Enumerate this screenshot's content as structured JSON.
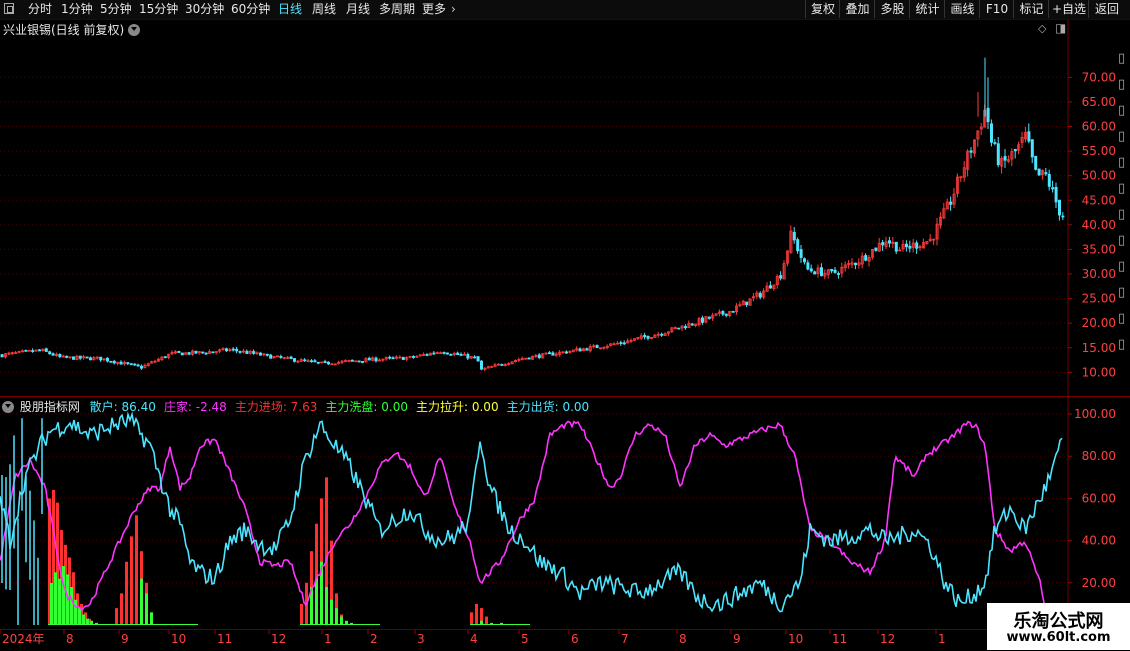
{
  "toolbar": {
    "periods": [
      "分时",
      "1分钟",
      "5分钟",
      "15分钟",
      "30分钟",
      "60分钟",
      "日线",
      "周线",
      "月线",
      "多周期",
      "更多"
    ],
    "active_period": "日线",
    "buttons": [
      "复权",
      "叠加",
      "多股",
      "统计",
      "画线",
      "F10",
      "标记",
      "+自选",
      "返回"
    ]
  },
  "main_panel": {
    "title": "兴业银锡(日线 前复权)",
    "up_color": "#ff3a3a",
    "down_color": "#4de4ff"
  },
  "indicator_panel": {
    "title": "股朋指标网",
    "legend": [
      {
        "label": "散户:",
        "value": "86.40",
        "color": "#4de4ff"
      },
      {
        "label": "庄家:",
        "value": "-2.48",
        "color": "#ff33ff"
      },
      {
        "label": "主力进场:",
        "value": "7.63",
        "color": "#ff3030"
      },
      {
        "label": "主力洗盘:",
        "value": "0.00",
        "color": "#33ff33"
      },
      {
        "label": "主力拉升:",
        "value": "0.00",
        "color": "#ffff33"
      },
      {
        "label": "主力出货:",
        "value": "0.00",
        "color": "#4de4ff"
      }
    ]
  },
  "logo": {
    "line1": "乐淘公式网",
    "line2": "www.60lt.com"
  },
  "chart_data": [
    {
      "type": "candlestick",
      "title": "兴业银锡(日线 前复权)",
      "ylim": [
        6,
        78
      ],
      "y_ticks": [
        10,
        15,
        20,
        25,
        30,
        35,
        40,
        45,
        50,
        55,
        60,
        65,
        70
      ],
      "x_labels": [
        "2024年",
        "8",
        "9",
        "10",
        "11",
        "12",
        "1",
        "2",
        "3",
        "4",
        "5",
        "6",
        "7",
        "8",
        "9",
        "10",
        "11",
        "12",
        "1"
      ],
      "grid": true,
      "close_anchors": [
        [
          0,
          13.5
        ],
        [
          40,
          14.5
        ],
        [
          60,
          13.0
        ],
        [
          100,
          12.8
        ],
        [
          140,
          11.0
        ],
        [
          170,
          13.8
        ],
        [
          200,
          14.0
        ],
        [
          230,
          14.6
        ],
        [
          270,
          13.2
        ],
        [
          320,
          11.8
        ],
        [
          370,
          12.6
        ],
        [
          410,
          13.0
        ],
        [
          440,
          14.3
        ],
        [
          476,
          12.8
        ],
        [
          480,
          10.5
        ],
        [
          520,
          12.8
        ],
        [
          575,
          14.5
        ],
        [
          620,
          16.0
        ],
        [
          660,
          18.0
        ],
        [
          700,
          20.5
        ],
        [
          730,
          22.5
        ],
        [
          760,
          26.0
        ],
        [
          780,
          30.0
        ],
        [
          790,
          38.0
        ],
        [
          795,
          36.0
        ],
        [
          805,
          31.0
        ],
        [
          830,
          30.0
        ],
        [
          860,
          33.0
        ],
        [
          885,
          37.0
        ],
        [
          900,
          35.0
        ],
        [
          930,
          37.0
        ],
        [
          950,
          45.0
        ],
        [
          965,
          53.0
        ],
        [
          975,
          58.0
        ],
        [
          985,
          64.0
        ],
        [
          990,
          57.0
        ],
        [
          1000,
          52.0
        ],
        [
          1015,
          55.0
        ],
        [
          1025,
          58.0
        ],
        [
          1035,
          50.0
        ],
        [
          1045,
          50.0
        ],
        [
          1060,
          42.0
        ]
      ]
    },
    {
      "type": "line+bar",
      "title": "股朋指标网",
      "ylim": [
        0,
        100
      ],
      "y_ticks": [
        20,
        40,
        60,
        80,
        100
      ],
      "series": [
        {
          "name": "散户",
          "color": "#4de4ff",
          "last": 86.4,
          "anchors": [
            [
              0,
              60
            ],
            [
              10,
              40
            ],
            [
              25,
              70
            ],
            [
              40,
              85
            ],
            [
              50,
              92
            ],
            [
              70,
              96
            ],
            [
              90,
              90
            ],
            [
              110,
              94
            ],
            [
              130,
              97
            ],
            [
              150,
              85
            ],
            [
              160,
              70
            ],
            [
              170,
              55
            ],
            [
              180,
              48
            ],
            [
              190,
              30
            ],
            [
              200,
              25
            ],
            [
              215,
              22
            ],
            [
              230,
              40
            ],
            [
              245,
              45
            ],
            [
              260,
              38
            ],
            [
              275,
              36
            ],
            [
              290,
              50
            ],
            [
              305,
              78
            ],
            [
              320,
              95
            ],
            [
              335,
              85
            ],
            [
              350,
              75
            ],
            [
              365,
              60
            ],
            [
              380,
              45
            ],
            [
              395,
              50
            ],
            [
              410,
              55
            ],
            [
              425,
              45
            ],
            [
              440,
              40
            ],
            [
              455,
              42
            ],
            [
              470,
              50
            ],
            [
              480,
              90
            ],
            [
              490,
              65
            ],
            [
              500,
              55
            ],
            [
              510,
              45
            ],
            [
              525,
              40
            ],
            [
              540,
              30
            ],
            [
              560,
              25
            ],
            [
              580,
              15
            ],
            [
              600,
              20
            ],
            [
              620,
              18
            ],
            [
              640,
              15
            ],
            [
              660,
              20
            ],
            [
              680,
              25
            ],
            [
              700,
              12
            ],
            [
              720,
              10
            ],
            [
              740,
              15
            ],
            [
              760,
              20
            ],
            [
              780,
              10
            ],
            [
              800,
              20
            ],
            [
              810,
              45
            ],
            [
              830,
              40
            ],
            [
              850,
              42
            ],
            [
              870,
              45
            ],
            [
              885,
              40
            ],
            [
              900,
              42
            ],
            [
              915,
              45
            ],
            [
              930,
              38
            ],
            [
              945,
              20
            ],
            [
              960,
              10
            ],
            [
              975,
              15
            ],
            [
              985,
              20
            ],
            [
              995,
              45
            ],
            [
              1010,
              55
            ],
            [
              1025,
              45
            ],
            [
              1040,
              60
            ],
            [
              1050,
              70
            ],
            [
              1062,
              86.4
            ]
          ]
        },
        {
          "name": "庄家",
          "color": "#ff33ff",
          "last": -2.48,
          "anchors": [
            [
              0,
              30
            ],
            [
              15,
              70
            ],
            [
              30,
              78
            ],
            [
              45,
              65
            ],
            [
              55,
              40
            ],
            [
              65,
              15
            ],
            [
              80,
              8
            ],
            [
              90,
              10
            ],
            [
              105,
              25
            ],
            [
              120,
              40
            ],
            [
              135,
              55
            ],
            [
              150,
              65
            ],
            [
              160,
              65
            ],
            [
              170,
              85
            ],
            [
              180,
              65
            ],
            [
              190,
              70
            ],
            [
              200,
              85
            ],
            [
              215,
              88
            ],
            [
              230,
              72
            ],
            [
              245,
              55
            ],
            [
              260,
              30
            ],
            [
              275,
              28
            ],
            [
              290,
              30
            ],
            [
              305,
              10
            ],
            [
              320,
              25
            ],
            [
              335,
              40
            ],
            [
              350,
              48
            ],
            [
              365,
              60
            ],
            [
              380,
              75
            ],
            [
              395,
              82
            ],
            [
              410,
              75
            ],
            [
              425,
              60
            ],
            [
              440,
              80
            ],
            [
              455,
              55
            ],
            [
              470,
              40
            ],
            [
              480,
              20
            ],
            [
              490,
              25
            ],
            [
              500,
              30
            ],
            [
              520,
              50
            ],
            [
              535,
              60
            ],
            [
              550,
              90
            ],
            [
              565,
              95
            ],
            [
              580,
              95
            ],
            [
              595,
              80
            ],
            [
              610,
              65
            ],
            [
              620,
              70
            ],
            [
              635,
              90
            ],
            [
              650,
              95
            ],
            [
              665,
              90
            ],
            [
              680,
              65
            ],
            [
              695,
              85
            ],
            [
              710,
              90
            ],
            [
              725,
              85
            ],
            [
              740,
              88
            ],
            [
              760,
              92
            ],
            [
              780,
              95
            ],
            [
              795,
              80
            ],
            [
              810,
              45
            ],
            [
              830,
              40
            ],
            [
              850,
              30
            ],
            [
              870,
              25
            ],
            [
              885,
              40
            ],
            [
              895,
              80
            ],
            [
              905,
              75
            ],
            [
              915,
              70
            ],
            [
              925,
              80
            ],
            [
              940,
              85
            ],
            [
              955,
              90
            ],
            [
              965,
              95
            ],
            [
              975,
              95
            ],
            [
              985,
              85
            ],
            [
              995,
              45
            ],
            [
              1010,
              35
            ],
            [
              1025,
              40
            ],
            [
              1040,
              20
            ],
            [
              1050,
              -2.48
            ]
          ]
        },
        {
          "name": "主力进场",
          "color": "#ff3030",
          "last": 7.63,
          "bars": [
            [
              48,
              60
            ],
            [
              52,
              64
            ],
            [
              56,
              58
            ],
            [
              60,
              45
            ],
            [
              64,
              38
            ],
            [
              68,
              32
            ],
            [
              72,
              25
            ],
            [
              76,
              15
            ],
            [
              80,
              10
            ],
            [
              84,
              6
            ],
            [
              88,
              3
            ],
            [
              115,
              8
            ],
            [
              120,
              15
            ],
            [
              125,
              30
            ],
            [
              130,
              42
            ],
            [
              135,
              52
            ],
            [
              140,
              35
            ],
            [
              145,
              20
            ],
            [
              150,
              5
            ],
            [
              300,
              10
            ],
            [
              305,
              20
            ],
            [
              310,
              35
            ],
            [
              315,
              48
            ],
            [
              320,
              60
            ],
            [
              325,
              70
            ],
            [
              330,
              40
            ],
            [
              335,
              15
            ],
            [
              340,
              5
            ],
            [
              470,
              6
            ],
            [
              475,
              10
            ],
            [
              480,
              8
            ],
            [
              485,
              4
            ]
          ]
        },
        {
          "name": "主力洗盘",
          "color": "#33ff33",
          "last": 0.0,
          "bars": [
            [
              50,
              20
            ],
            [
              54,
              25
            ],
            [
              58,
              22
            ],
            [
              62,
              28
            ],
            [
              66,
              24
            ],
            [
              70,
              18
            ],
            [
              74,
              12
            ],
            [
              78,
              8
            ],
            [
              82,
              5
            ],
            [
              86,
              3
            ],
            [
              90,
              2
            ],
            [
              95,
              1
            ],
            [
              140,
              22
            ],
            [
              145,
              15
            ],
            [
              150,
              6
            ],
            [
              310,
              18
            ],
            [
              315,
              22
            ],
            [
              320,
              30
            ],
            [
              325,
              18
            ],
            [
              330,
              12
            ],
            [
              335,
              8
            ],
            [
              340,
              4
            ],
            [
              345,
              2
            ],
            [
              350,
              1
            ],
            [
              480,
              2
            ],
            [
              490,
              1
            ],
            [
              500,
              1
            ]
          ]
        },
        {
          "name": "主力拉升",
          "color": "#ffff33",
          "last": 0.0
        },
        {
          "name": "主力出货",
          "color": "#4de4ff",
          "last": 0.0
        }
      ]
    }
  ]
}
